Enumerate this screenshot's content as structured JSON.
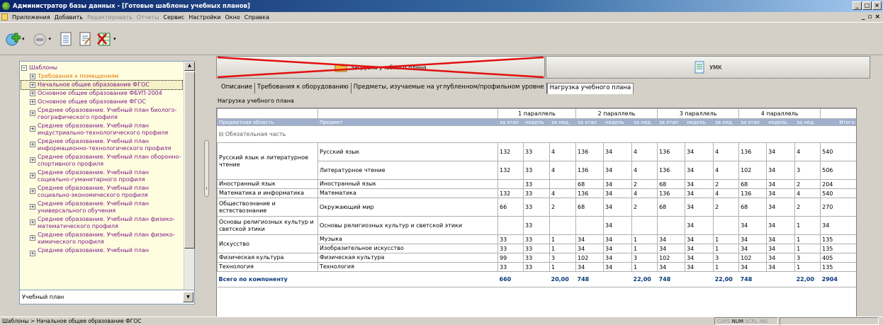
{
  "window": {
    "title": "Администратор базы данных - [Готовые шаблоны учебных планов]"
  },
  "menu": {
    "items": [
      {
        "label": "Приложения",
        "disabled": false
      },
      {
        "label": "Добавить",
        "disabled": false
      },
      {
        "label": "Редактировать",
        "disabled": true
      },
      {
        "label": "Отчеты",
        "disabled": true
      },
      {
        "label": "Сервис",
        "disabled": false
      },
      {
        "label": "Настройки",
        "disabled": false
      },
      {
        "label": "Окно",
        "disabled": false
      },
      {
        "label": "Справка",
        "disabled": false
      }
    ]
  },
  "toolbar": {
    "icons": [
      "add-icon",
      "remove-icon",
      "document-icon",
      "document-edit-icon",
      "excel-export-icon"
    ]
  },
  "tree": {
    "root": "Шаблоны",
    "nodes": [
      {
        "label": "Требования к помещениям",
        "style": "orange"
      },
      {
        "label": "Начальное общее образование ФГОС",
        "style": "sel"
      },
      {
        "label": "Основное общее образование ФБУП-2004",
        "style": ""
      },
      {
        "label": "Основное общее образование ФГОС",
        "style": ""
      },
      {
        "label": "Среднее образование. Учебный план биолого-географического профиля",
        "style": "two"
      },
      {
        "label": "Среднее образование. Учебный план индустриально-технологического профиля",
        "style": "two"
      },
      {
        "label": "Среднее образование. Учебный план информационно-технологического профиля",
        "style": "two"
      },
      {
        "label": "Среднее образование. Учебный план оборонно-спортивного профиля",
        "style": "two"
      },
      {
        "label": "Среднее образование. Учебный план социально-гуманитарного профиля",
        "style": "two"
      },
      {
        "label": "Среднее образование. Учебный план социально-экономического профиля",
        "style": "two"
      },
      {
        "label": "Среднее образование. Учебный план универсального обучения",
        "style": "two"
      },
      {
        "label": "Среднее образование. Учебный план физико-математического профиля",
        "style": "two"
      },
      {
        "label": "Среднее образование. Учебный план физико-химического профиля",
        "style": "two"
      },
      {
        "label": "Среднее образование. Учебный план",
        "style": "two"
      }
    ],
    "combo_value": "Учебный план"
  },
  "buttons": {
    "load_label": "Загрузка учебного плана",
    "umk_label": "УМК"
  },
  "tabs": [
    {
      "label": "Описание",
      "active": false
    },
    {
      "label": "Требования к оборудованию",
      "active": false
    },
    {
      "label": "Предметы, изучаемые на углубленном/профильном уровне",
      "active": false
    },
    {
      "label": "Нагрузка учебного плана",
      "active": true
    }
  ],
  "section_title": "Нагрузка учебного плана",
  "grid": {
    "parallels": [
      "1 параллель",
      "2 параллель",
      "3 параллель",
      "4 параллель"
    ],
    "headers": {
      "area": "Предметная область",
      "subject": "Предмет",
      "per_stage": "за этап",
      "weeks": "недель",
      "per_week": "за нед.",
      "total": "Итого:"
    },
    "group": "Обязательная часть",
    "rows": [
      {
        "area": "Русский язык и литературное чтение",
        "area_rows": 2,
        "subject": "Русский язык",
        "vals": [
          "132",
          "33",
          "4",
          "136",
          "34",
          "4",
          "136",
          "34",
          "4",
          "136",
          "34",
          "4"
        ],
        "total": "540",
        "big": true
      },
      {
        "area": null,
        "subject": "Литературное чтение",
        "vals": [
          "132",
          "33",
          "4",
          "136",
          "34",
          "4",
          "136",
          "34",
          "4",
          "102",
          "34",
          "3"
        ],
        "total": "506",
        "big": true
      },
      {
        "area": "Иностранный язык",
        "area_rows": 1,
        "subject": "Иностранный язык",
        "vals": [
          "",
          "33",
          "",
          "68",
          "34",
          "2",
          "68",
          "34",
          "2",
          "68",
          "34",
          "2"
        ],
        "total": "204",
        "big": false
      },
      {
        "area": "Математика и информатика",
        "area_rows": 1,
        "subject": "Математика",
        "vals": [
          "132",
          "33",
          "4",
          "136",
          "34",
          "4",
          "136",
          "34",
          "4",
          "136",
          "34",
          "4"
        ],
        "total": "540",
        "big": false
      },
      {
        "area": "Обществознание и естествознание",
        "area_rows": 1,
        "subject": "Окружающий мир",
        "vals": [
          "66",
          "33",
          "2",
          "68",
          "34",
          "2",
          "68",
          "34",
          "2",
          "68",
          "34",
          "2"
        ],
        "total": "270",
        "big": true
      },
      {
        "area": "Основы религиозных культур и светской этики",
        "area_rows": 1,
        "subject": "Основы религиозных культур и светской этики",
        "vals": [
          "",
          "33",
          "",
          "",
          "34",
          "",
          "",
          "34",
          "",
          "34",
          "34",
          "1"
        ],
        "total": "34",
        "big": true
      },
      {
        "area": "Искусство",
        "area_rows": 2,
        "subject": "Музыка",
        "vals": [
          "33",
          "33",
          "1",
          "34",
          "34",
          "1",
          "34",
          "34",
          "1",
          "34",
          "34",
          "1"
        ],
        "total": "135",
        "big": false
      },
      {
        "area": null,
        "subject": "Изобразительное искусство",
        "vals": [
          "33",
          "33",
          "1",
          "34",
          "34",
          "1",
          "34",
          "34",
          "1",
          "34",
          "34",
          "1"
        ],
        "total": "135",
        "big": false
      },
      {
        "area": "Физическая культура",
        "area_rows": 1,
        "subject": "Физическая культура",
        "vals": [
          "99",
          "33",
          "3",
          "102",
          "34",
          "3",
          "102",
          "34",
          "3",
          "102",
          "34",
          "3"
        ],
        "total": "405",
        "big": false
      },
      {
        "area": "Технология",
        "area_rows": 1,
        "subject": "Технология",
        "vals": [
          "33",
          "33",
          "1",
          "34",
          "34",
          "1",
          "34",
          "34",
          "1",
          "34",
          "34",
          "1"
        ],
        "total": "135",
        "big": false
      }
    ],
    "total_row": {
      "label": "Всего по компоненту",
      "vals": [
        "660",
        "",
        "20,00",
        "748",
        "",
        "22,00",
        "748",
        "",
        "22,00",
        "748",
        "",
        "22,00"
      ],
      "total": "2904"
    }
  },
  "status": {
    "path": "Шаблоны > Начальное общее образование ФГОС",
    "caps": "CAPS",
    "num": "NUM",
    "scrl": "SCRL",
    "ins": "INS"
  },
  "colors": {
    "title_start": "#0a246a",
    "header_bg": "#9fb0cf",
    "tree_bg": "#fffde0",
    "tree_text": "#7b1a86",
    "tree_orange": "#e07800",
    "cross": "#e01010",
    "total_text": "#0a3a7a"
  }
}
